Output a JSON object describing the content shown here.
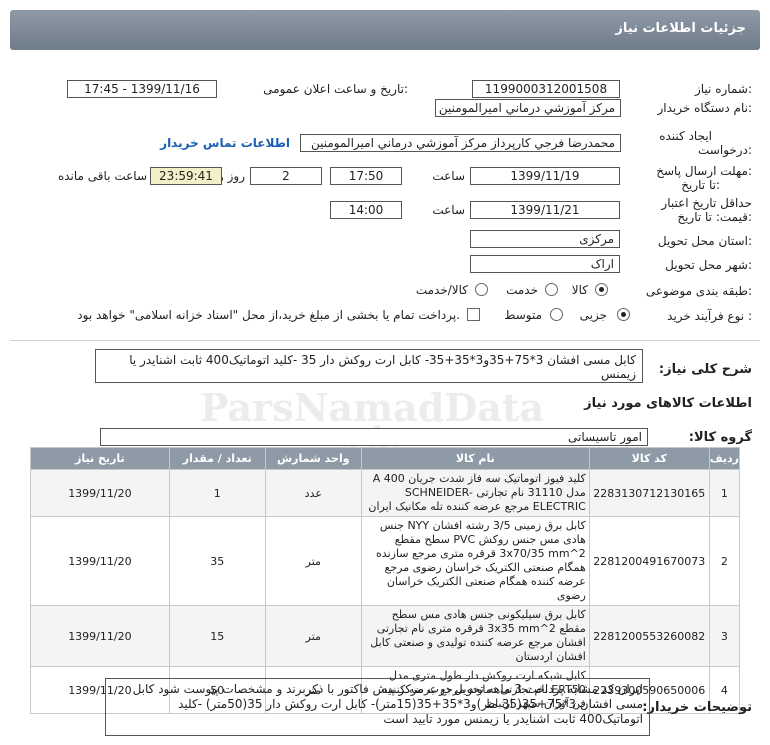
{
  "header": {
    "title": "جزئیات اطلاعات نیاز"
  },
  "form": {
    "need_number": {
      "label": "شماره نیاز:",
      "value": "1199000312001508"
    },
    "announce_datetime": {
      "label": "تاریخ و ساعت اعلان عمومی:",
      "value": "1399/11/16 - 17:45"
    },
    "buyer_org": {
      "label": "نام دستگاه خریدار:",
      "value": "مرکز آموزشي درماني اميرالمومنين"
    },
    "creator": {
      "label_line1": "ایجاد کننده",
      "label_line2": "درخواست:",
      "value": "محمدرضا فرجي کارپرداز مرکز آموزشي درماني اميرالمومنين",
      "contact_link": "اطلاعات تماس خریدار"
    },
    "response_deadline": {
      "label_line1": "مهلت ارسال پاسخ:",
      "label_line2": "تا تاریخ:",
      "date": "1399/11/19",
      "time_label": "ساعت",
      "time": "17:50",
      "days": "2",
      "days_label": "روز و",
      "remaining": "23:59:41",
      "remaining_label": "ساعت باقی مانده"
    },
    "price_validity": {
      "label_line1": "حداقل تاریخ اعتبار",
      "label_line2": "قیمت: تا تاریخ:",
      "date": "1399/11/21",
      "time_label": "ساعت",
      "time": "14:00"
    },
    "province": {
      "label": "استان محل تحویل:",
      "value": "مرکزی"
    },
    "city": {
      "label": "شهر محل تحویل:",
      "value": "اراک"
    },
    "category": {
      "label": "طبقه بندی موضوعی:",
      "options": [
        "کالا",
        "خدمت",
        "کالا/خدمت"
      ],
      "selected": "کالا"
    },
    "process_type": {
      "label": "نوع فرآیند خرید :",
      "options": [
        "جزیی",
        "متوسط"
      ],
      "selected": "جزیی",
      "payment_note": "پرداخت تمام یا بخشی از مبلغ خرید،از محل \"اسناد خزانه اسلامی\" خواهد بود."
    }
  },
  "description": {
    "label": "شرح کلی نیاز:",
    "value": "کابل مسی افشان 3*75+35و3*35+35- کابل ارت روکش دار 35 -کلید اتوماتیک400 ثابت اشنایدر یا زیمنس"
  },
  "goods_section": {
    "title": "اطلاعات کالاهای مورد نیاز",
    "group_label": "گروه کالا:",
    "group_value": "امور تاسیساتی"
  },
  "table": {
    "headers": [
      "ردیف",
      "کد کالا",
      "نام کالا",
      "واحد شمارش",
      "تعداد / مقدار",
      "تاریخ نیاز"
    ],
    "rows": [
      {
        "row": "1",
        "code": "2283130712130165",
        "name": "کلید فیوز اتوماتیک سه فاز شدت جریان 400 A مدل 31110 نام تجارتی SCHNEIDER-ELECTRIC مرجع عرضه کننده تله مکانیک ایران",
        "unit": "عدد",
        "qty": "1",
        "date": "1399/11/20"
      },
      {
        "row": "2",
        "code": "2281200491670073",
        "name": "کابل برق زمینی 3/5 رشته افشان NYY جنس هادی مس جنس روکش PVC سطح مقطع 2^3x70/35 mm قرقره متری مرجع سازنده همگام صنعتی الکتریک خراسان رضوی مرجع عرضه کننده همگام صنعتی الکتریک خراسان رضوی",
        "unit": "متر",
        "qty": "35",
        "date": "1399/11/20"
      },
      {
        "row": "3",
        "code": "2281200553260082",
        "name": "کابل برق سیلیکونی جنس هادی مس سطح مقطع 3x35 mm^2 قرقره متری نام تجارتی افشان مرجع عرضه کننده تولیدی و صنعتی کابل افشان اردستان",
        "unit": "متر",
        "qty": "15",
        "date": "1399/11/20"
      },
      {
        "row": "4",
        "code": "2239300590650006",
        "name": "کابل شبکه ارت روکش دار طول متری مدل ERT50 نام تجارتی دماوند مرجع عرضه کننده فن آوران سپهر ارتباط",
        "unit": "متر",
        "qty": "50",
        "date": "1399/11/20"
      }
    ]
  },
  "notes": {
    "label": "توضیحات خریدار:",
    "value": "ایران کد مشابه پرداخت 3 ماهه تحویل درب مرکز پیش فاکتور با ذکربرند و مشخصات پیوست شود کابل مسی افشان 3*75+35(35 متر)و3*35+35(15متر)- کابل ارت روکش دار 35(50متر) -کلید اتوماتیک400 ثابت اشنایدر یا زیمنس مورد تایید است"
  },
  "watermark": {
    "brand": "ParsNamadData",
    "tagline": "پارس نماد داده"
  }
}
